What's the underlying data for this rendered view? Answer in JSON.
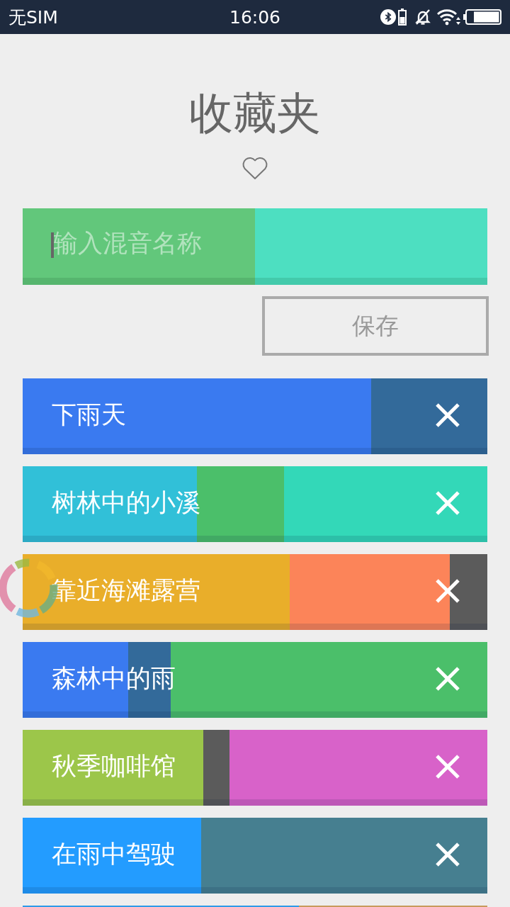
{
  "status_bar": {
    "carrier": "无SIM",
    "time": "16:06"
  },
  "header": {
    "title": "收藏夹"
  },
  "name_input": {
    "placeholder": "输入混音名称",
    "focused": true,
    "segments": [
      {
        "color": "#62c77b",
        "level": 0.5
      },
      {
        "color": "#4ddfc1",
        "level": 0.5
      }
    ]
  },
  "save_button": {
    "label": "保存"
  },
  "mixes": [
    {
      "name": "下雨天",
      "segments": [
        {
          "color": "#3a7af0",
          "level": 0.75
        },
        {
          "color": "#336a9a",
          "level": 0.25
        }
      ]
    },
    {
      "name": "树林中的小溪",
      "segments": [
        {
          "color": "#31c0d8",
          "level": 0.375
        },
        {
          "color": "#4bbf6a",
          "level": 0.1875
        },
        {
          "color": "#33d8b8",
          "level": 0.4375
        }
      ]
    },
    {
      "name": "靠近海滩露营",
      "segments": [
        {
          "color": "#e9ae2a",
          "level": 0.575
        },
        {
          "color": "#fc8459",
          "level": 0.344
        },
        {
          "color": "#5b5b5b",
          "level": 0.081
        }
      ]
    },
    {
      "name": "森林中的雨",
      "segments": [
        {
          "color": "#3a7af0",
          "level": 0.227
        },
        {
          "color": "#336a9a",
          "level": 0.092
        },
        {
          "color": "#4bbf6a",
          "level": 0.681
        }
      ]
    },
    {
      "name": "秋季咖啡馆",
      "segments": [
        {
          "color": "#9cc64a",
          "level": 0.389
        },
        {
          "color": "#5b5b5b",
          "level": 0.056
        },
        {
          "color": "#d862c9",
          "level": 0.555
        }
      ]
    },
    {
      "name": "在雨中驾驶",
      "segments": [
        {
          "color": "#239cff",
          "level": 0.384
        },
        {
          "color": "#467f90",
          "level": 0.616
        }
      ]
    },
    {
      "segments": [
        {
          "color": "#2e9ae8",
          "level": 0.595
        },
        {
          "color": "#c89a5c",
          "level": 0.405
        }
      ]
    }
  ]
}
